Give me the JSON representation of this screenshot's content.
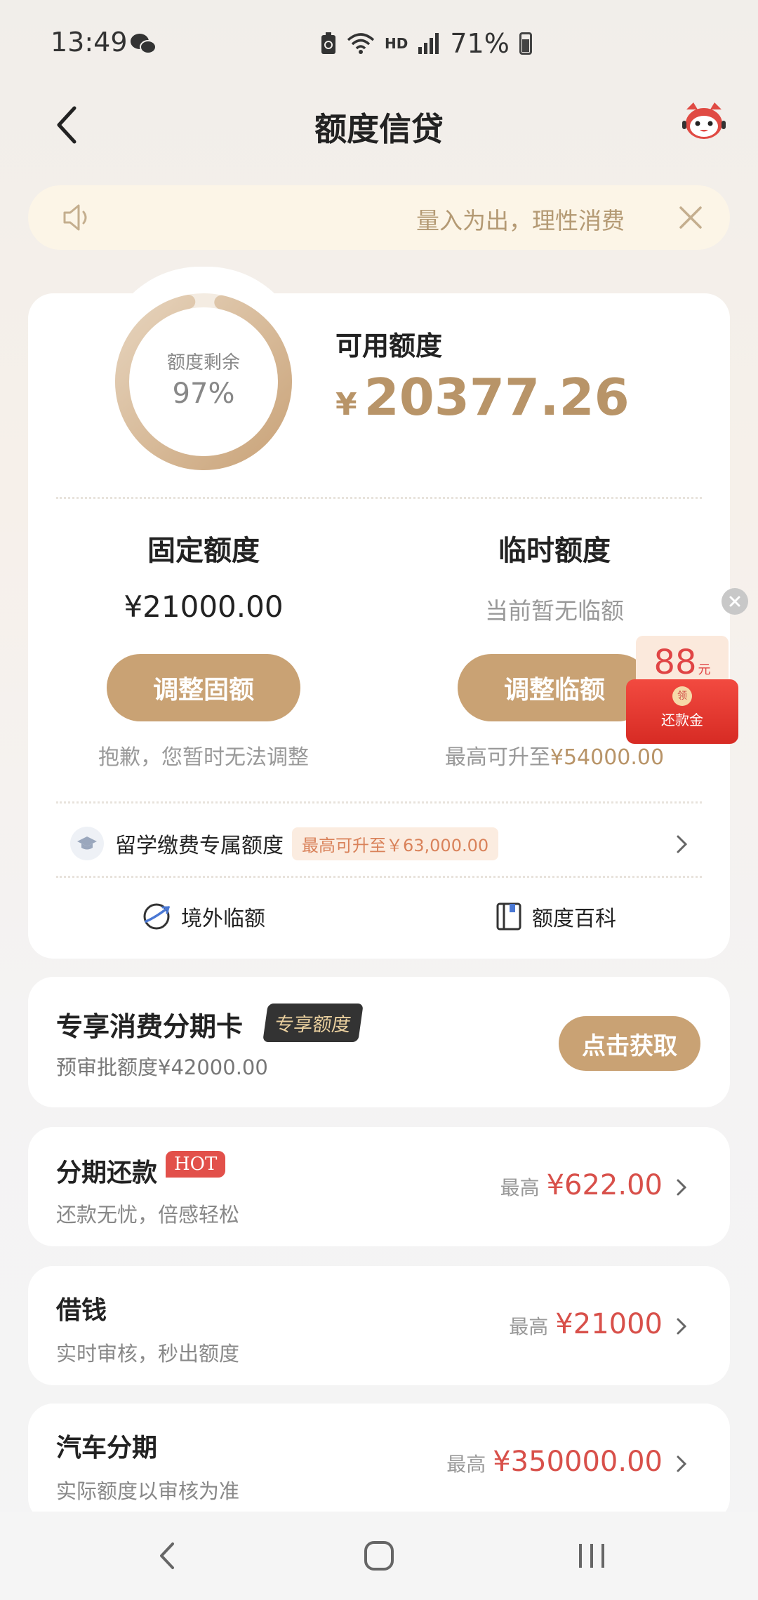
{
  "status_bar": {
    "time": "13:49",
    "network_label": "HD",
    "battery": "71%"
  },
  "header": {
    "title": "额度信贷"
  },
  "notice": {
    "text": "量入为出，理性消费"
  },
  "credit": {
    "ring_label": "额度剩余",
    "ring_percent": "97%",
    "ring_fraction": 0.97,
    "available_label": "可用额度",
    "currency": "¥",
    "available_amount": "20377.26"
  },
  "fixed": {
    "title": "固定额度",
    "value": "¥21000.00",
    "button": "调整固额",
    "note": "抱歉，您暂时无法调整"
  },
  "temporary": {
    "title": "临时额度",
    "value": "当前暂无临额",
    "button": "调整临额",
    "note_prefix": "最高可升至",
    "note_value": "¥54000.00"
  },
  "study_abroad": {
    "label": "留学缴费专属额度",
    "badge": "最高可升至￥63,000.00"
  },
  "tools": [
    {
      "label": "境外临额"
    },
    {
      "label": "额度百科"
    }
  ],
  "red_packet": {
    "amount": "88",
    "unit": "元",
    "label": "还款金",
    "seal": "领"
  },
  "consumer_card": {
    "title": "专享消费分期卡",
    "badge": "专享额度",
    "subtitle": "预审批额度¥42000.00",
    "button": "点击获取"
  },
  "products": [
    {
      "title": "分期还款",
      "badge": "HOT",
      "subtitle": "还款无忧，倍感轻松",
      "max_label": "最高",
      "value": "¥622.00"
    },
    {
      "title": "借钱",
      "subtitle": "实时审核，秒出额度",
      "max_label": "最高",
      "value": "¥21000"
    },
    {
      "title": "汽车分期",
      "subtitle": "实际额度以审核为准",
      "max_label": "最高",
      "value": "¥350000.00"
    }
  ],
  "colors": {
    "accent_gold": "#c9a274",
    "amount_gold": "#b89468",
    "price_red": "#d8504a",
    "hot_red": "#e2504a"
  }
}
